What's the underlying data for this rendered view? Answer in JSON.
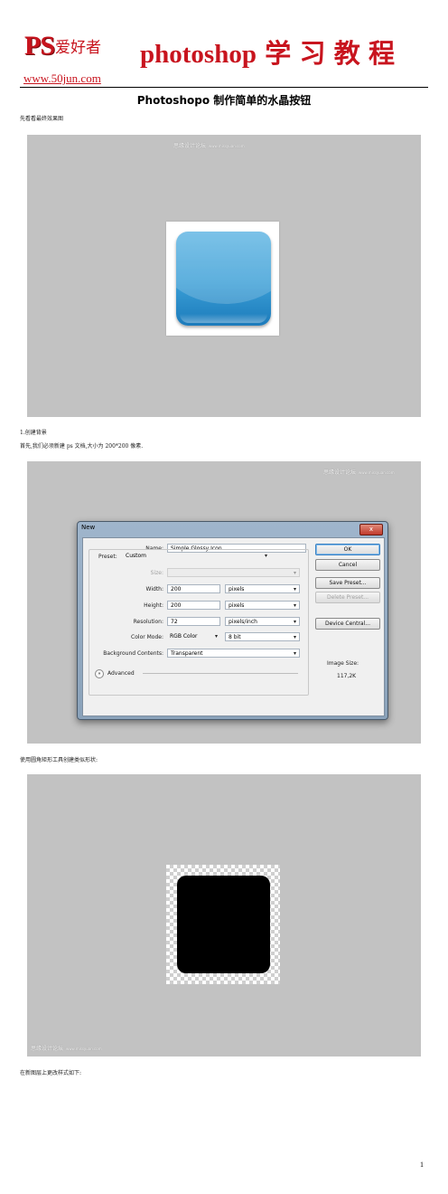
{
  "header": {
    "logo_ps": "PS",
    "logo_cn": "爱好者",
    "title": "photoshop 学 习 教 程",
    "url": "www.50jun.com"
  },
  "document": {
    "title": "Photoshopo 制作简单的水晶按钮",
    "page_number": "1"
  },
  "paragraphs": {
    "p1": "先看看最终效果图",
    "step1_heading": "1.创建背景",
    "step1_text": "首先,我们必须新建 ps 文档,大小为 200*200 像素.",
    "p3": "使用圆角矩形工具创建类似形状:",
    "p4": "在新图层上更改样式如下:"
  },
  "watermarks": {
    "fig1": "思缘设计论坛",
    "fig1_url": "www.missyuan.com",
    "fig2": "思缘设计论坛",
    "fig2_url": "www.missyuan.com",
    "fig3": "思缘设计论坛",
    "fig3_url": "www.missyuan.com"
  },
  "new_dialog": {
    "title": "New",
    "close_glyph": "x",
    "name_label": "Name:",
    "name_value": "Simple Glossy Icon",
    "preset_label": "Preset:",
    "preset_value": "Custom",
    "size_label": "Size:",
    "size_value": "",
    "width_label": "Width:",
    "width_value": "200",
    "width_unit": "pixels",
    "height_label": "Height:",
    "height_value": "200",
    "height_unit": "pixels",
    "resolution_label": "Resolution:",
    "resolution_value": "72",
    "resolution_unit": "pixels/inch",
    "color_mode_label": "Color Mode:",
    "color_mode_value": "RGB Color",
    "bit_depth_value": "8 bit",
    "background_label": "Background Contents:",
    "background_value": "Transparent",
    "advanced_label": "Advanced",
    "advanced_glyph": "»",
    "ok_label": "OK",
    "cancel_label": "Cancel",
    "save_preset_label": "Save Preset...",
    "delete_preset_label": "Delete Preset...",
    "device_central_label": "Device Central...",
    "image_size_label": "Image Size:",
    "image_size_value": "117,2K"
  },
  "colors": {
    "brand_red": "#c8141e",
    "screenshot_gray": "#c2c2c2",
    "icon_blue": "#3a9ed6"
  }
}
